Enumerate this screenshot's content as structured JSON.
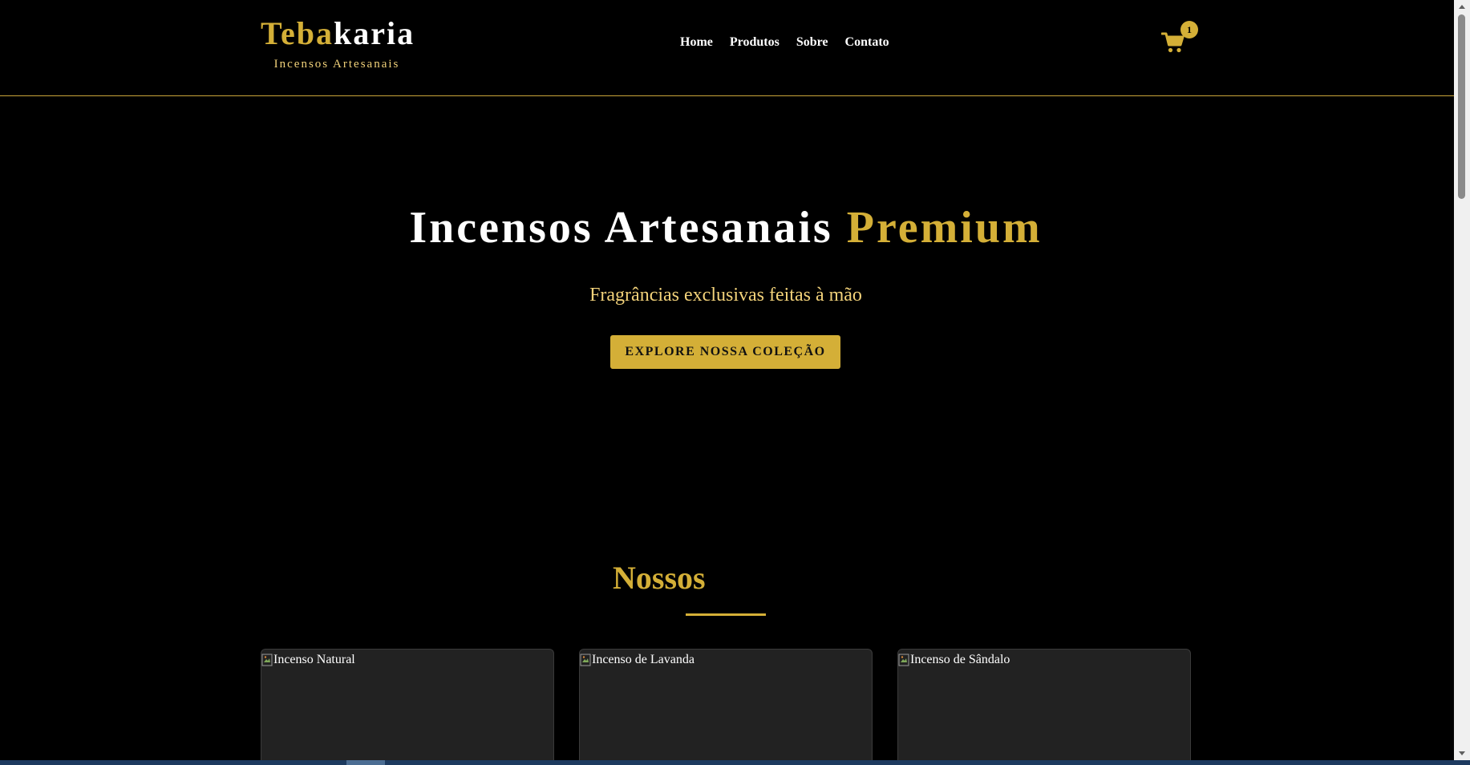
{
  "header": {
    "brand_part1": "Teba",
    "brand_part2": "karia",
    "tagline": "Incensos Artesanais",
    "nav": [
      "Home",
      "Produtos",
      "Sobre",
      "Contato"
    ],
    "cart_count": "1"
  },
  "hero": {
    "title_part1": "Incensos Artesanais ",
    "title_part2": "Premium",
    "subtitle": "Fragrâncias exclusivas feitas à mão",
    "cta_label": "EXPLORE NOSSA COLEÇÃO"
  },
  "products": {
    "heading": "Nossos",
    "cards": [
      {
        "alt": "Incenso Natural"
      },
      {
        "alt": "Incenso de Lavanda"
      },
      {
        "alt": "Incenso de Sândalo"
      }
    ]
  },
  "colors": {
    "gold": "#d4af37",
    "light_gold": "#f2d27a",
    "background": "#000000",
    "card": "#222222"
  },
  "icons": {
    "cart": "shopping-cart-icon",
    "broken_image": "broken-image-icon"
  }
}
